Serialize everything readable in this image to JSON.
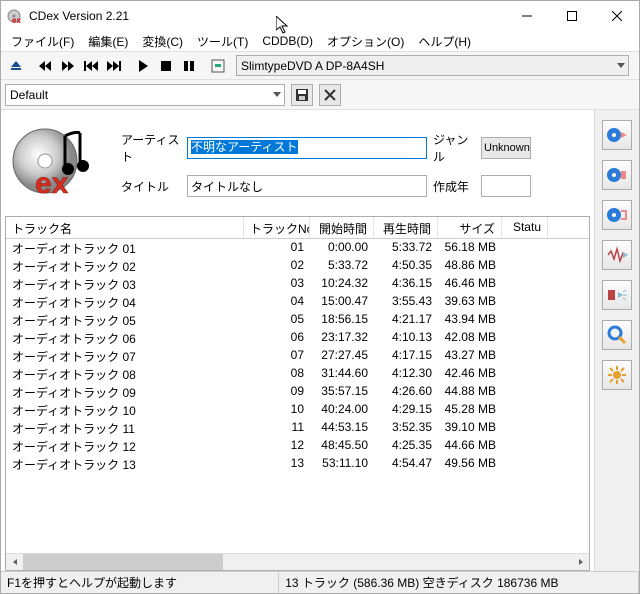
{
  "window": {
    "title": "CDex Version 2.21"
  },
  "menu": {
    "file": "ファイル(F)",
    "edit": "編集(E)",
    "convert": "変換(C)",
    "tools": "ツール(T)",
    "cddb": "CDDB(D)",
    "options": "オプション(O)",
    "help": "ヘルプ(H)"
  },
  "drive": {
    "selected": "SlimtypeDVD A  DP-8A4SH"
  },
  "profile": {
    "selected": "Default"
  },
  "fields": {
    "artist_label": "アーティスト",
    "artist_value": "不明なアーティスト",
    "title_label": "タイトル",
    "title_value": "タイトルなし",
    "genre_label": "ジャンル",
    "genre_button": "Unknown",
    "year_label": "作成年"
  },
  "columns": {
    "name": "トラック名",
    "no": "トラックNo",
    "start": "開始時間",
    "play": "再生時間",
    "size": "サイズ",
    "status": "Statu"
  },
  "tracks": [
    {
      "name": "オーディオトラック 01",
      "no": "01",
      "start": "0:00.00",
      "play": "5:33.72",
      "size": "56.18 MB"
    },
    {
      "name": "オーディオトラック 02",
      "no": "02",
      "start": "5:33.72",
      "play": "4:50.35",
      "size": "48.86 MB"
    },
    {
      "name": "オーディオトラック 03",
      "no": "03",
      "start": "10:24.32",
      "play": "4:36.15",
      "size": "46.46 MB"
    },
    {
      "name": "オーディオトラック 04",
      "no": "04",
      "start": "15:00.47",
      "play": "3:55.43",
      "size": "39.63 MB"
    },
    {
      "name": "オーディオトラック 05",
      "no": "05",
      "start": "18:56.15",
      "play": "4:21.17",
      "size": "43.94 MB"
    },
    {
      "name": "オーディオトラック 06",
      "no": "06",
      "start": "23:17.32",
      "play": "4:10.13",
      "size": "42.08 MB"
    },
    {
      "name": "オーディオトラック 07",
      "no": "07",
      "start": "27:27.45",
      "play": "4:17.15",
      "size": "43.27 MB"
    },
    {
      "name": "オーディオトラック 08",
      "no": "08",
      "start": "31:44.60",
      "play": "4:12.30",
      "size": "42.46 MB"
    },
    {
      "name": "オーディオトラック 09",
      "no": "09",
      "start": "35:57.15",
      "play": "4:26.60",
      "size": "44.88 MB"
    },
    {
      "name": "オーディオトラック 10",
      "no": "10",
      "start": "40:24.00",
      "play": "4:29.15",
      "size": "45.28 MB"
    },
    {
      "name": "オーディオトラック 11",
      "no": "11",
      "start": "44:53.15",
      "play": "3:52.35",
      "size": "39.10 MB"
    },
    {
      "name": "オーディオトラック 12",
      "no": "12",
      "start": "48:45.50",
      "play": "4:25.35",
      "size": "44.66 MB"
    },
    {
      "name": "オーディオトラック 13",
      "no": "13",
      "start": "53:11.10",
      "play": "4:54.47",
      "size": "49.56 MB"
    }
  ],
  "status": {
    "help": "F1を押すとヘルプが起動します",
    "summary": "13 トラック (586.36 MB) 空きディスク 186736 MB"
  }
}
